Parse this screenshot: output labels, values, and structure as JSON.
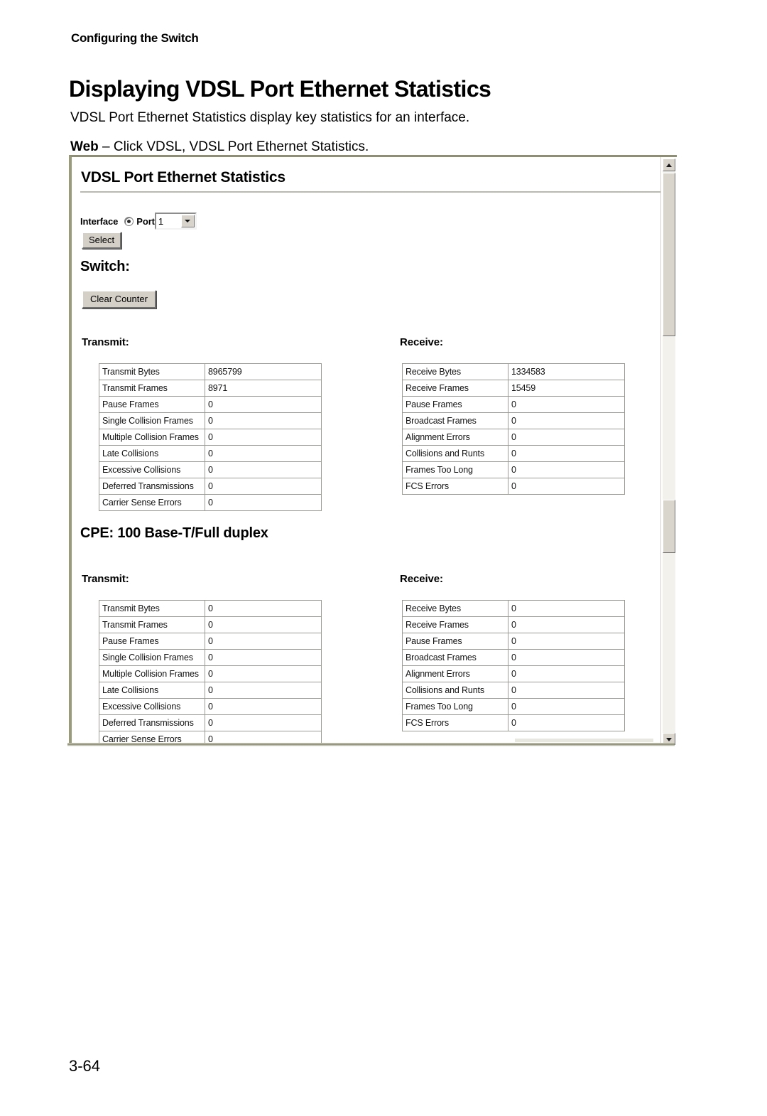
{
  "document": {
    "running_head": "Configuring the Switch",
    "title": "Displaying VDSL Port Ethernet Statistics",
    "intro": "VDSL Port Ethernet Statistics display key statistics for an interface.",
    "web_label": "Web",
    "web_instruction": "– Click VDSL, VDSL Port Ethernet Statistics.",
    "page_number": "3-64"
  },
  "screenshot": {
    "panel_title": "VDSL Port Ethernet Statistics",
    "interface": {
      "label": "Interface",
      "radio_label": "Port",
      "radio_selected": true,
      "port_value": "1",
      "select_button": "Select"
    },
    "switch_section": {
      "heading": "Switch:",
      "clear_button": "Clear Counter",
      "transmit_heading": "Transmit:",
      "receive_heading": "Receive:",
      "transmit_rows": [
        {
          "name": "Transmit Bytes",
          "value": "8965799"
        },
        {
          "name": "Transmit Frames",
          "value": "8971"
        },
        {
          "name": "Pause Frames",
          "value": "0"
        },
        {
          "name": "Single Collision Frames",
          "value": "0"
        },
        {
          "name": "Multiple Collision Frames",
          "value": "0"
        },
        {
          "name": "Late Collisions",
          "value": "0"
        },
        {
          "name": "Excessive Collisions",
          "value": "0"
        },
        {
          "name": "Deferred Transmissions",
          "value": "0"
        },
        {
          "name": "Carrier Sense Errors",
          "value": "0"
        }
      ],
      "receive_rows": [
        {
          "name": "Receive Bytes",
          "value": "1334583"
        },
        {
          "name": "Receive Frames",
          "value": "15459"
        },
        {
          "name": "Pause Frames",
          "value": "0"
        },
        {
          "name": "Broadcast Frames",
          "value": "0"
        },
        {
          "name": "Alignment Errors",
          "value": "0"
        },
        {
          "name": "Collisions and Runts",
          "value": "0"
        },
        {
          "name": "Frames Too Long",
          "value": "0"
        },
        {
          "name": "FCS Errors",
          "value": "0"
        }
      ]
    },
    "cpe_section": {
      "heading": "CPE: 100 Base-T/Full duplex",
      "transmit_heading": "Transmit:",
      "receive_heading": "Receive:",
      "transmit_rows": [
        {
          "name": "Transmit Bytes",
          "value": "0"
        },
        {
          "name": "Transmit Frames",
          "value": "0"
        },
        {
          "name": "Pause Frames",
          "value": "0"
        },
        {
          "name": "Single Collision Frames",
          "value": "0"
        },
        {
          "name": "Multiple Collision Frames",
          "value": "0"
        },
        {
          "name": "Late Collisions",
          "value": "0"
        },
        {
          "name": "Excessive Collisions",
          "value": "0"
        },
        {
          "name": "Deferred Transmissions",
          "value": "0"
        },
        {
          "name": "Carrier Sense Errors",
          "value": "0"
        }
      ],
      "receive_rows": [
        {
          "name": "Receive Bytes",
          "value": "0"
        },
        {
          "name": "Receive Frames",
          "value": "0"
        },
        {
          "name": "Pause Frames",
          "value": "0"
        },
        {
          "name": "Broadcast Frames",
          "value": "0"
        },
        {
          "name": "Alignment Errors",
          "value": "0"
        },
        {
          "name": "Collisions and Runts",
          "value": "0"
        },
        {
          "name": "Frames Too Long",
          "value": "0"
        },
        {
          "name": "FCS Errors",
          "value": "0"
        }
      ]
    },
    "scrollbar": {
      "up_icon": "caret-up-icon",
      "down_icon": "caret-down-icon"
    },
    "colors": {
      "frame_border": "#8e8e74",
      "button_face": "#d4d0c8",
      "table_border": "#9b9b93"
    }
  }
}
